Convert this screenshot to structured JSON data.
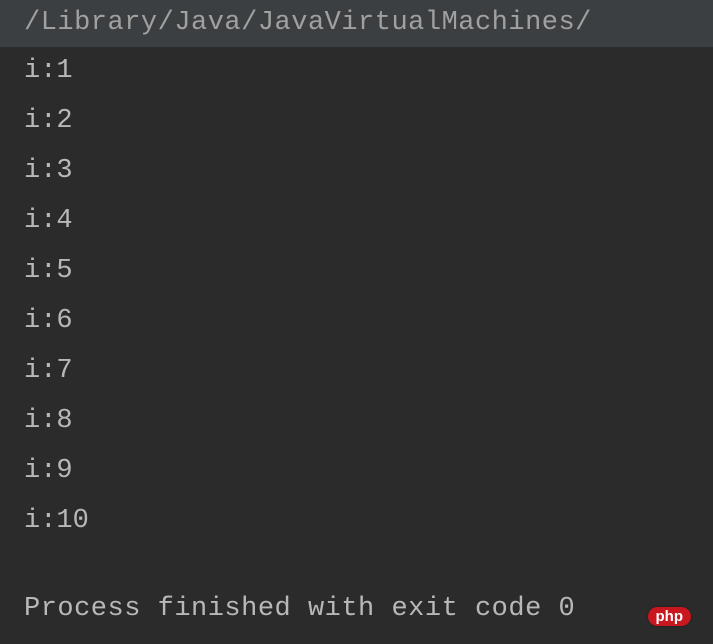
{
  "console": {
    "path": "/Library/Java/JavaVirtualMachines/",
    "lines": [
      "i:1",
      "i:2",
      "i:3",
      "i:4",
      "i:5",
      "i:6",
      "i:7",
      "i:8",
      "i:9",
      "i:10"
    ],
    "exit_message": "Process finished with exit code 0"
  },
  "watermark": {
    "badge": "php",
    "suffix": ""
  }
}
